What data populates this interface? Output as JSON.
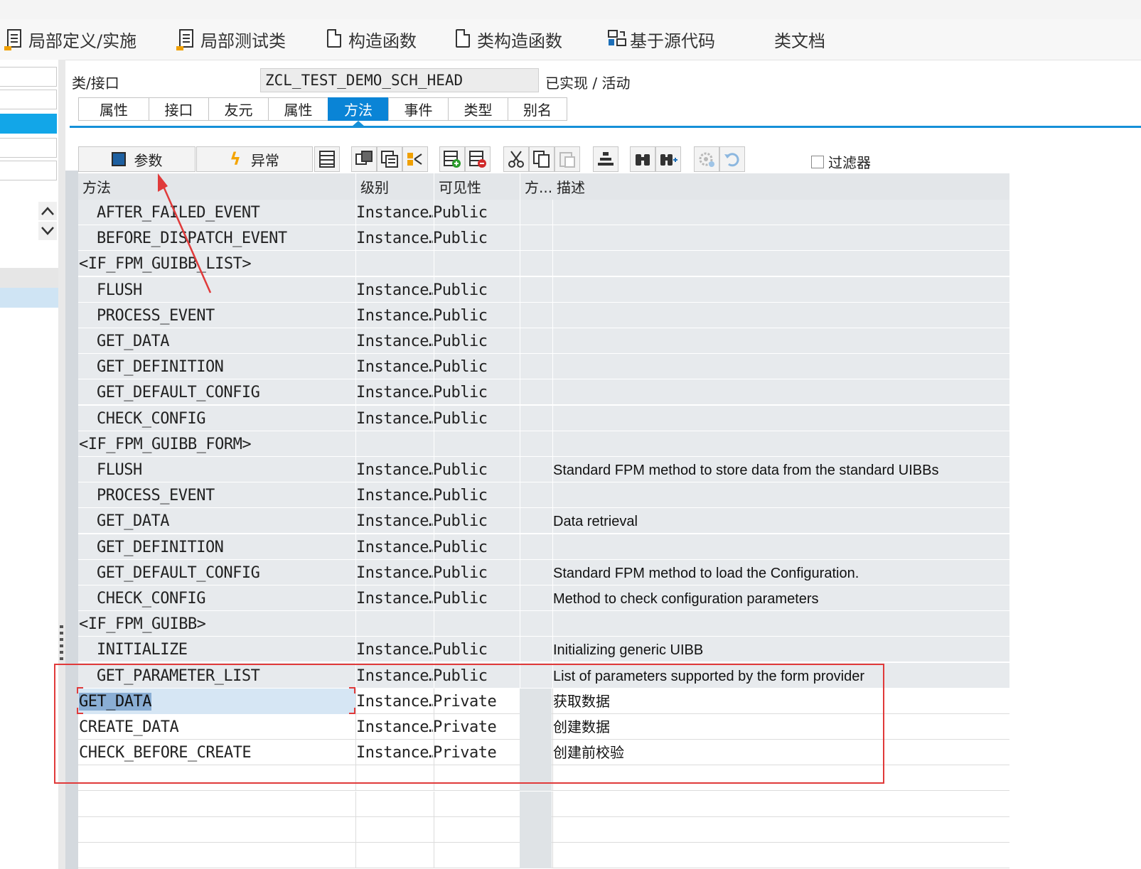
{
  "app_toolbar": {
    "items": [
      {
        "label": "局部定义/实施",
        "icon": "local-definitions-icon"
      },
      {
        "label": "局部测试类",
        "icon": "local-test-classes-icon"
      },
      {
        "label": "构造函数",
        "icon": "constructor-icon"
      },
      {
        "label": "类构造函数",
        "icon": "class-constructor-icon"
      },
      {
        "label": "基于源代码",
        "icon": "source-code-icon"
      },
      {
        "label": "类文档",
        "icon": ""
      }
    ]
  },
  "header": {
    "class_label": "类/接口",
    "class_value": "ZCL_TEST_DEMO_SCH_HEAD",
    "status": "已实现 / 活动"
  },
  "tabs": [
    {
      "label": "属性",
      "active": false
    },
    {
      "label": "接口",
      "active": false
    },
    {
      "label": "友元",
      "active": false
    },
    {
      "label": "属性",
      "active": false
    },
    {
      "label": "方法",
      "active": true
    },
    {
      "label": "事件",
      "active": false
    },
    {
      "label": "类型",
      "active": false
    },
    {
      "label": "别名",
      "active": false
    }
  ],
  "method_toolbar": {
    "params_label": "参数",
    "exceptions_label": "异常",
    "filter_label": "过滤器"
  },
  "grid": {
    "columns": [
      "方法",
      "级别",
      "可见性",
      "方...",
      "描述"
    ],
    "rows": [
      {
        "method": "AFTER_FAILED_EVENT",
        "indent": true,
        "level": "Instance…",
        "visibility": "Public",
        "desc": "",
        "style": "gray"
      },
      {
        "method": "BEFORE_DISPATCH_EVENT",
        "indent": true,
        "level": "Instance…",
        "visibility": "Public",
        "desc": "",
        "style": "gray"
      },
      {
        "method": "<IF_FPM_GUIBB_LIST>",
        "indent": false,
        "level": "",
        "visibility": "",
        "desc": "",
        "style": "gray"
      },
      {
        "method": "FLUSH",
        "indent": true,
        "level": "Instance…",
        "visibility": "Public",
        "desc": "",
        "style": "gray"
      },
      {
        "method": "PROCESS_EVENT",
        "indent": true,
        "level": "Instance…",
        "visibility": "Public",
        "desc": "",
        "style": "gray"
      },
      {
        "method": "GET_DATA",
        "indent": true,
        "level": "Instance…",
        "visibility": "Public",
        "desc": "",
        "style": "gray"
      },
      {
        "method": "GET_DEFINITION",
        "indent": true,
        "level": "Instance…",
        "visibility": "Public",
        "desc": "",
        "style": "gray"
      },
      {
        "method": "GET_DEFAULT_CONFIG",
        "indent": true,
        "level": "Instance…",
        "visibility": "Public",
        "desc": "",
        "style": "gray"
      },
      {
        "method": "CHECK_CONFIG",
        "indent": true,
        "level": "Instance…",
        "visibility": "Public",
        "desc": "",
        "style": "gray"
      },
      {
        "method": "<IF_FPM_GUIBB_FORM>",
        "indent": false,
        "level": "",
        "visibility": "",
        "desc": "",
        "style": "gray"
      },
      {
        "method": "FLUSH",
        "indent": true,
        "level": "Instance…",
        "visibility": "Public",
        "desc": "Standard FPM method to store data from the standard UIBBs",
        "style": "gray"
      },
      {
        "method": "PROCESS_EVENT",
        "indent": true,
        "level": "Instance…",
        "visibility": "Public",
        "desc": "",
        "style": "gray"
      },
      {
        "method": "GET_DATA",
        "indent": true,
        "level": "Instance…",
        "visibility": "Public",
        "desc": "Data retrieval",
        "style": "gray"
      },
      {
        "method": "GET_DEFINITION",
        "indent": true,
        "level": "Instance…",
        "visibility": "Public",
        "desc": "",
        "style": "gray"
      },
      {
        "method": "GET_DEFAULT_CONFIG",
        "indent": true,
        "level": "Instance…",
        "visibility": "Public",
        "desc": "Standard FPM method to load the Configuration.",
        "style": "gray"
      },
      {
        "method": "CHECK_CONFIG",
        "indent": true,
        "level": "Instance…",
        "visibility": "Public",
        "desc": "Method to check configuration parameters",
        "style": "gray"
      },
      {
        "method": "<IF_FPM_GUIBB>",
        "indent": false,
        "level": "",
        "visibility": "",
        "desc": "",
        "style": "gray"
      },
      {
        "method": "INITIALIZE",
        "indent": true,
        "level": "Instance…",
        "visibility": "Public",
        "desc": "Initializing generic UIBB",
        "style": "gray"
      },
      {
        "method": "GET_PARAMETER_LIST",
        "indent": true,
        "level": "Instance…",
        "visibility": "Public",
        "desc": "List of parameters supported by the form provider",
        "style": "gray"
      },
      {
        "method": "GET_DATA",
        "indent": false,
        "level": "Instance…",
        "visibility": "Private",
        "desc": "获取数据",
        "style": "white",
        "selected": true
      },
      {
        "method": "CREATE_DATA",
        "indent": false,
        "level": "Instance…",
        "visibility": "Private",
        "desc": "创建数据",
        "style": "white"
      },
      {
        "method": "CHECK_BEFORE_CREATE",
        "indent": false,
        "level": "Instance…",
        "visibility": "Private",
        "desc": "创建前校验",
        "style": "white"
      },
      {
        "method": "",
        "indent": false,
        "level": "",
        "visibility": "",
        "desc": "",
        "style": "white"
      },
      {
        "method": "",
        "indent": false,
        "level": "",
        "visibility": "",
        "desc": "",
        "style": "white"
      },
      {
        "method": "",
        "indent": false,
        "level": "",
        "visibility": "",
        "desc": "",
        "style": "white"
      },
      {
        "method": "",
        "indent": false,
        "level": "",
        "visibility": "",
        "desc": "",
        "style": "white"
      }
    ]
  },
  "colors": {
    "active_tab": "#0a84d6",
    "annotation_red": "#e03a3a",
    "row_gray": "#e7eaed"
  }
}
